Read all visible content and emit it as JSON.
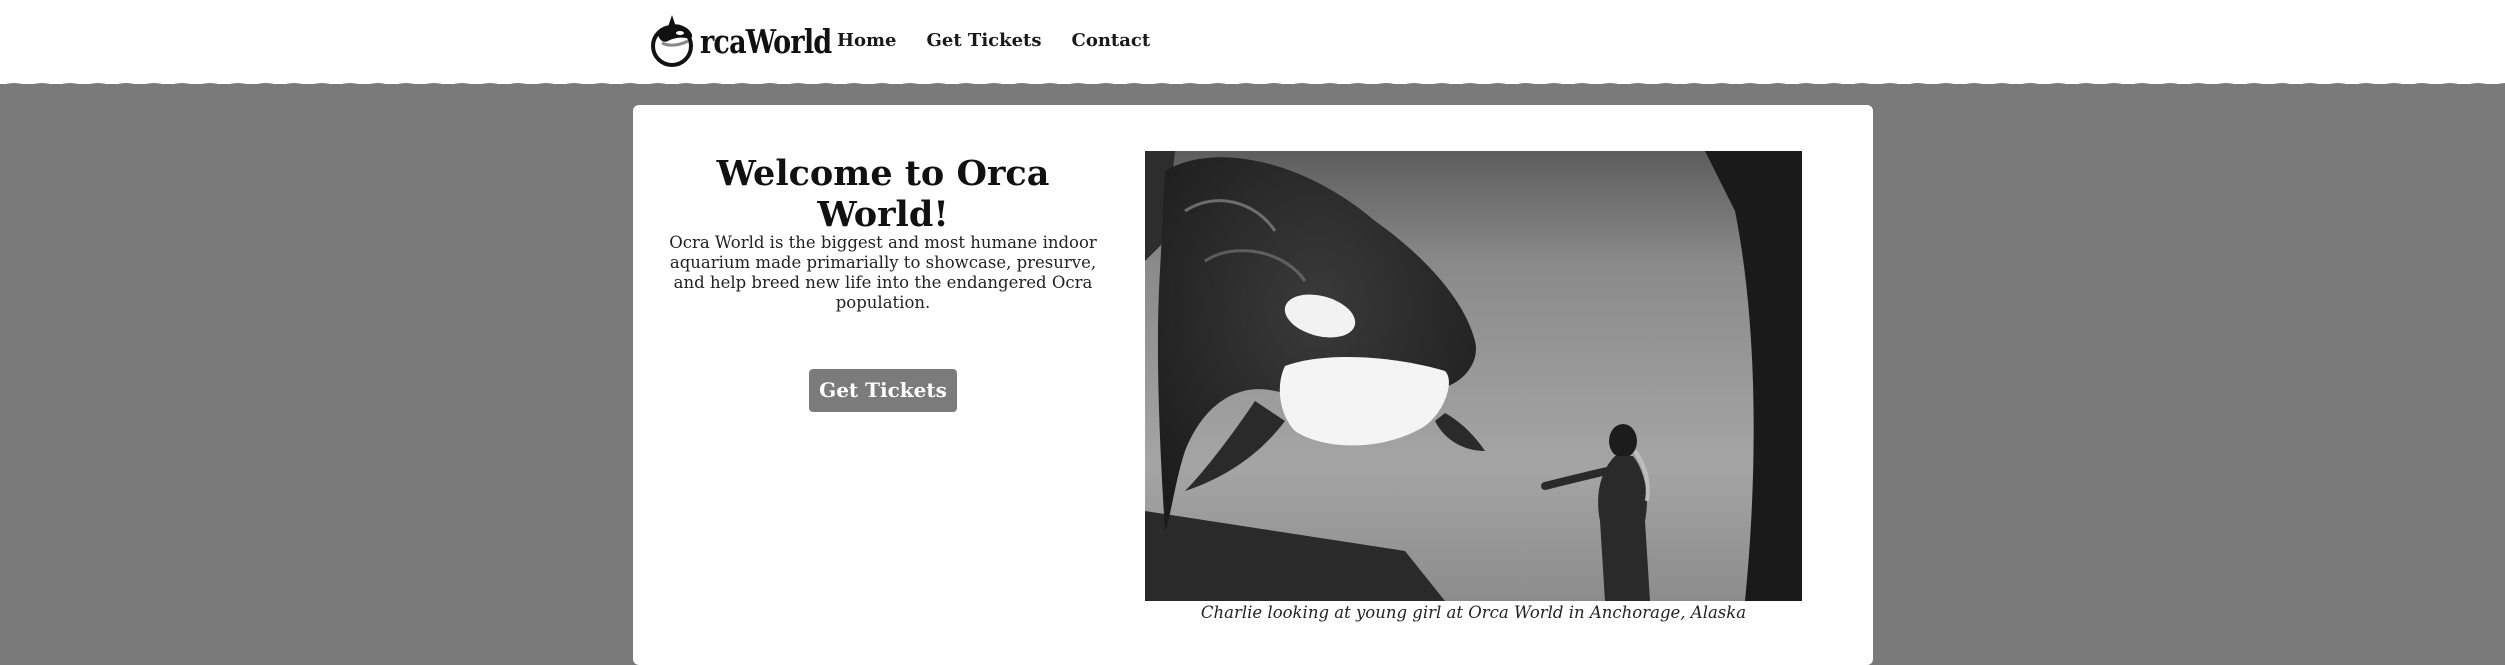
{
  "header": {
    "logo_text": "rcaWorld",
    "logo_icon": "orca-icon",
    "nav": [
      {
        "label": "Home"
      },
      {
        "label": "Get Tickets"
      },
      {
        "label": "Contact"
      }
    ]
  },
  "main": {
    "title": "Welcome to Orca World!",
    "description": "Ocra World is the biggest and most humane indoor aquarium made primarially to showcase, presurve, and help breed new life into the endangered Ocra population.",
    "cta_label": "Get Tickets",
    "photo_caption": "Charlie looking at young girl at Orca World in Anchorage, Alaska"
  },
  "colors": {
    "page_background": "#7a7a7a",
    "header_background": "#ffffff",
    "button_background": "#7b7b7b",
    "button_text": "#ffffff"
  }
}
